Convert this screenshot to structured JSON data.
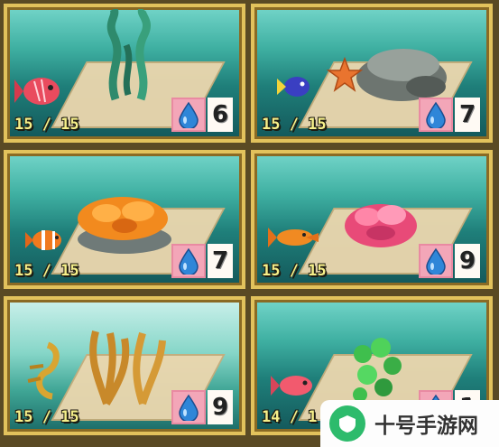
{
  "cards": [
    {
      "count": "15 / 15",
      "cost": "6"
    },
    {
      "count": "15 / 15",
      "cost": "7"
    },
    {
      "count": "15 / 15",
      "cost": "7"
    },
    {
      "count": "15 / 15",
      "cost": "9"
    },
    {
      "count": "15 / 15",
      "cost": "9"
    },
    {
      "count": "14 / 1",
      "cost": "1"
    }
  ],
  "icons": {
    "currency": "water-drop-icon"
  },
  "watermark": {
    "brand": "十号手游网"
  }
}
